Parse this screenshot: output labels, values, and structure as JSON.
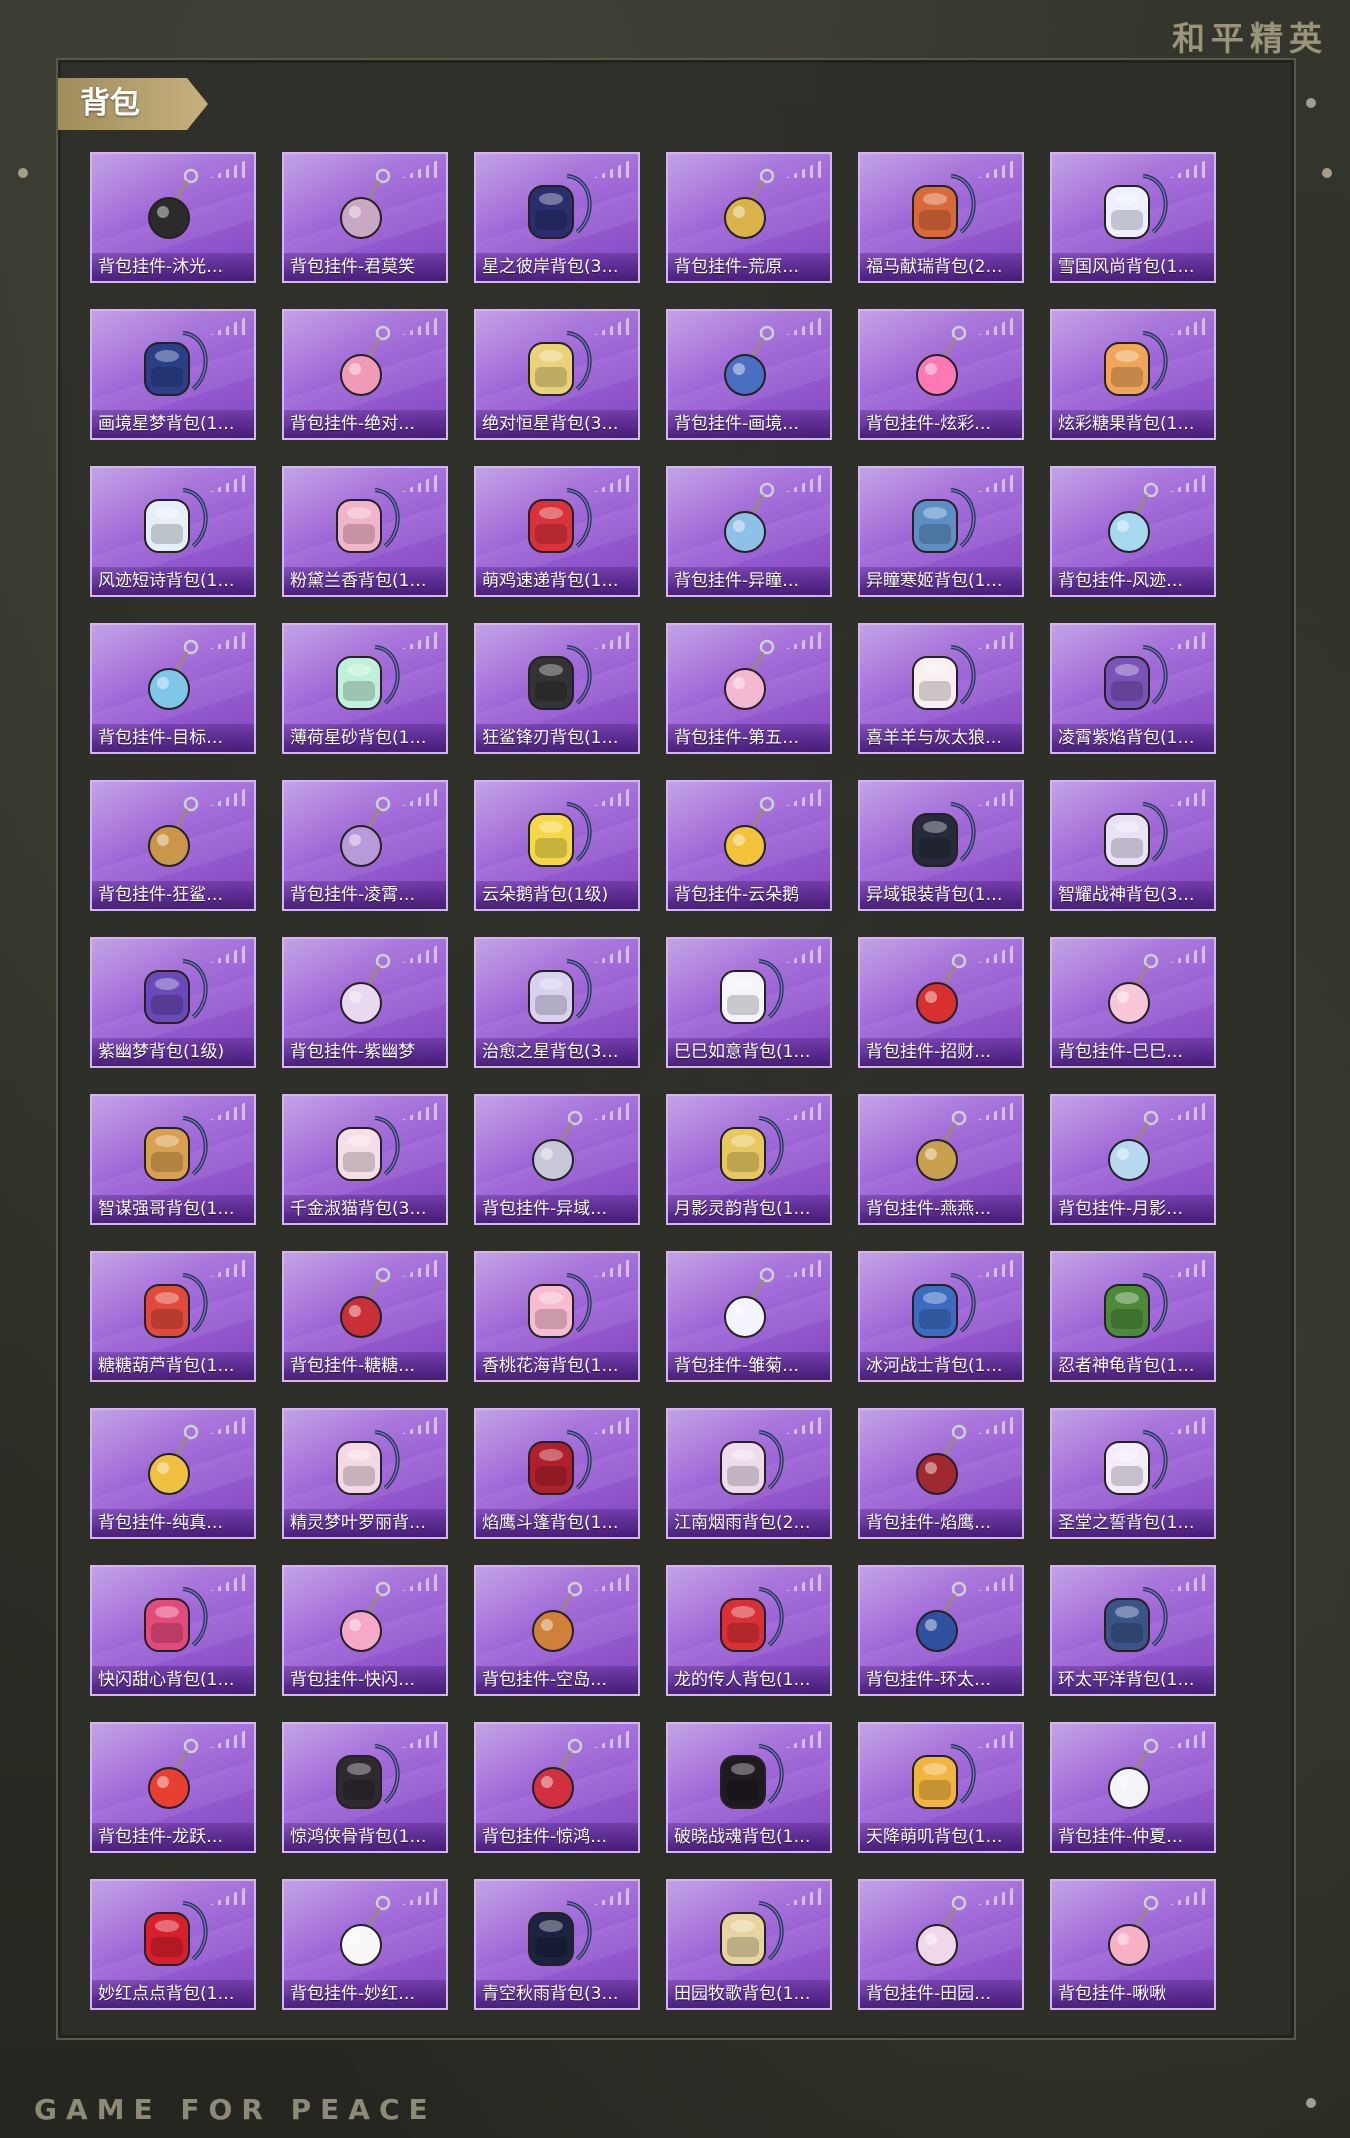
{
  "header": {
    "brand_cn": "和平精英",
    "brand_en": "GAME FOR PEACE"
  },
  "section": {
    "title": "背包"
  },
  "colors": {
    "card_top": "#b992e2",
    "card_bottom": "#7f45bc",
    "tag": "#c7b27e"
  },
  "items": [
    {
      "name": "背包挂件-沐光…",
      "kind": "charm",
      "color": "#2b2b2b"
    },
    {
      "name": "背包挂件-君莫笑",
      "kind": "charm",
      "color": "#c9a8c4"
    },
    {
      "name": "星之彼岸背包(3…",
      "kind": "backpack",
      "color": "#2a2e6e"
    },
    {
      "name": "背包挂件-荒原…",
      "kind": "charm",
      "color": "#d9b24a"
    },
    {
      "name": "福马献瑞背包(2…",
      "kind": "backpack",
      "color": "#d86a3a"
    },
    {
      "name": "雪国风尚背包(1…",
      "kind": "backpack",
      "color": "#eef0ff"
    },
    {
      "name": "画境星梦背包(1…",
      "kind": "backpack",
      "color": "#2a3f88"
    },
    {
      "name": "背包挂件-绝对…",
      "kind": "charm",
      "color": "#f09ab8"
    },
    {
      "name": "绝对恒星背包(3…",
      "kind": "backpack",
      "color": "#e9d27a"
    },
    {
      "name": "背包挂件-画境…",
      "kind": "charm",
      "color": "#4a6ec0"
    },
    {
      "name": "背包挂件-炫彩…",
      "kind": "charm",
      "color": "#ff7ab4"
    },
    {
      "name": "炫彩糖果背包(1…",
      "kind": "backpack",
      "color": "#f0a55a"
    },
    {
      "name": "风迹短诗背包(1…",
      "kind": "backpack",
      "color": "#e6eef8"
    },
    {
      "name": "粉黛兰香背包(1…",
      "kind": "backpack",
      "color": "#f1b5c9"
    },
    {
      "name": "萌鸡速递背包(1…",
      "kind": "backpack",
      "color": "#d9323a"
    },
    {
      "name": "背包挂件-异瞳…",
      "kind": "charm",
      "color": "#8fc0e8"
    },
    {
      "name": "异瞳寒姬背包(1…",
      "kind": "backpack",
      "color": "#5d8fc4"
    },
    {
      "name": "背包挂件-风迹…",
      "kind": "charm",
      "color": "#a6d9f0"
    },
    {
      "name": "背包挂件-目标…",
      "kind": "charm",
      "color": "#7fc6e8"
    },
    {
      "name": "薄荷星砂背包(1…",
      "kind": "backpack",
      "color": "#bff0d8"
    },
    {
      "name": "狂鲨锋刃背包(1…",
      "kind": "backpack",
      "color": "#333333"
    },
    {
      "name": "背包挂件-第五…",
      "kind": "charm",
      "color": "#f5b8d2"
    },
    {
      "name": "喜羊羊与灰太狼…",
      "kind": "backpack",
      "color": "#f8f0f0"
    },
    {
      "name": "凌霄紫焰背包(1…",
      "kind": "backpack",
      "color": "#7a52b8"
    },
    {
      "name": "背包挂件-狂鲨…",
      "kind": "charm",
      "color": "#c9964a"
    },
    {
      "name": "背包挂件-凌霄…",
      "kind": "charm",
      "color": "#b89ad8"
    },
    {
      "name": "云朵鹅背包(1级)",
      "kind": "backpack",
      "color": "#f5d84a"
    },
    {
      "name": "背包挂件-云朵鹅",
      "kind": "charm",
      "color": "#f2c23a"
    },
    {
      "name": "异域银装背包(1…",
      "kind": "backpack",
      "color": "#262a3a"
    },
    {
      "name": "智耀战神背包(3…",
      "kind": "backpack",
      "color": "#e8e2f4"
    },
    {
      "name": "紫幽梦背包(1级)",
      "kind": "backpack",
      "color": "#6a4ab8"
    },
    {
      "name": "背包挂件-紫幽梦",
      "kind": "charm",
      "color": "#e8d8f0"
    },
    {
      "name": "治愈之星背包(3…",
      "kind": "backpack",
      "color": "#d8d2ee"
    },
    {
      "name": "巳巳如意背包(1…",
      "kind": "backpack",
      "color": "#f4f4fa"
    },
    {
      "name": "背包挂件-招财…",
      "kind": "charm",
      "color": "#d8302e"
    },
    {
      "name": "背包挂件-巳巳…",
      "kind": "charm",
      "color": "#f8c8d8"
    },
    {
      "name": "智谋强哥背包(1…",
      "kind": "backpack",
      "color": "#d8a050"
    },
    {
      "name": "千金淑猫背包(3…",
      "kind": "backpack",
      "color": "#f6dde6"
    },
    {
      "name": "背包挂件-异域…",
      "kind": "charm",
      "color": "#c8c8d8"
    },
    {
      "name": "月影灵韵背包(1…",
      "kind": "backpack",
      "color": "#e8c860"
    },
    {
      "name": "背包挂件-燕燕…",
      "kind": "charm",
      "color": "#c8a050"
    },
    {
      "name": "背包挂件-月影…",
      "kind": "charm",
      "color": "#b8d8f0"
    },
    {
      "name": "糖糖葫芦背包(1…",
      "kind": "backpack",
      "color": "#e04a3a"
    },
    {
      "name": "背包挂件-糖糖…",
      "kind": "charm",
      "color": "#c83038"
    },
    {
      "name": "香桃花海背包(1…",
      "kind": "backpack",
      "color": "#f7bcd0"
    },
    {
      "name": "背包挂件-雏菊…",
      "kind": "charm",
      "color": "#f4f4ff"
    },
    {
      "name": "冰河战士背包(1…",
      "kind": "backpack",
      "color": "#3c6cc0"
    },
    {
      "name": "忍者神龟背包(1…",
      "kind": "backpack",
      "color": "#4c8a3a"
    },
    {
      "name": "背包挂件-纯真…",
      "kind": "charm",
      "color": "#f0c040"
    },
    {
      "name": "精灵梦叶罗丽背…",
      "kind": "backpack",
      "color": "#f4d8e4"
    },
    {
      "name": "焰鹰斗篷背包(1…",
      "kind": "backpack",
      "color": "#b0202c"
    },
    {
      "name": "江南烟雨背包(2…",
      "kind": "backpack",
      "color": "#eedcec"
    },
    {
      "name": "背包挂件-焰鹰…",
      "kind": "charm",
      "color": "#a02830"
    },
    {
      "name": "圣堂之誓背包(1…",
      "kind": "backpack",
      "color": "#f4ecf8"
    },
    {
      "name": "快闪甜心背包(1…",
      "kind": "backpack",
      "color": "#e24a7c"
    },
    {
      "name": "背包挂件-快闪…",
      "kind": "charm",
      "color": "#f6a8c8"
    },
    {
      "name": "背包挂件-空岛…",
      "kind": "charm",
      "color": "#d0803a"
    },
    {
      "name": "龙的传人背包(1…",
      "kind": "backpack",
      "color": "#d83034"
    },
    {
      "name": "背包挂件-环太…",
      "kind": "charm",
      "color": "#3050a0"
    },
    {
      "name": "环太平洋背包(1…",
      "kind": "backpack",
      "color": "#3a5488"
    },
    {
      "name": "背包挂件-龙跃…",
      "kind": "charm",
      "color": "#e84030"
    },
    {
      "name": "惊鸿侠骨背包(1…",
      "kind": "backpack",
      "color": "#2e2a30"
    },
    {
      "name": "背包挂件-惊鸿…",
      "kind": "charm",
      "color": "#d03040"
    },
    {
      "name": "破晓战魂背包(1…",
      "kind": "backpack",
      "color": "#1e1a20"
    },
    {
      "name": "天降萌叽背包(1…",
      "kind": "backpack",
      "color": "#f0b440"
    },
    {
      "name": "背包挂件-仲夏…",
      "kind": "charm",
      "color": "#f4f4f8"
    },
    {
      "name": "妙红点点背包(1…",
      "kind": "backpack",
      "color": "#d8202c"
    },
    {
      "name": "背包挂件-妙红…",
      "kind": "charm",
      "color": "#f8f8f8"
    },
    {
      "name": "青空秋雨背包(3…",
      "kind": "backpack",
      "color": "#1c2240"
    },
    {
      "name": "田园牧歌背包(1…",
      "kind": "backpack",
      "color": "#e8d4a0"
    },
    {
      "name": "背包挂件-田园…",
      "kind": "charm",
      "color": "#f0d8e8"
    },
    {
      "name": "背包挂件-啾啾",
      "kind": "charm",
      "color": "#f7b0c4"
    }
  ]
}
